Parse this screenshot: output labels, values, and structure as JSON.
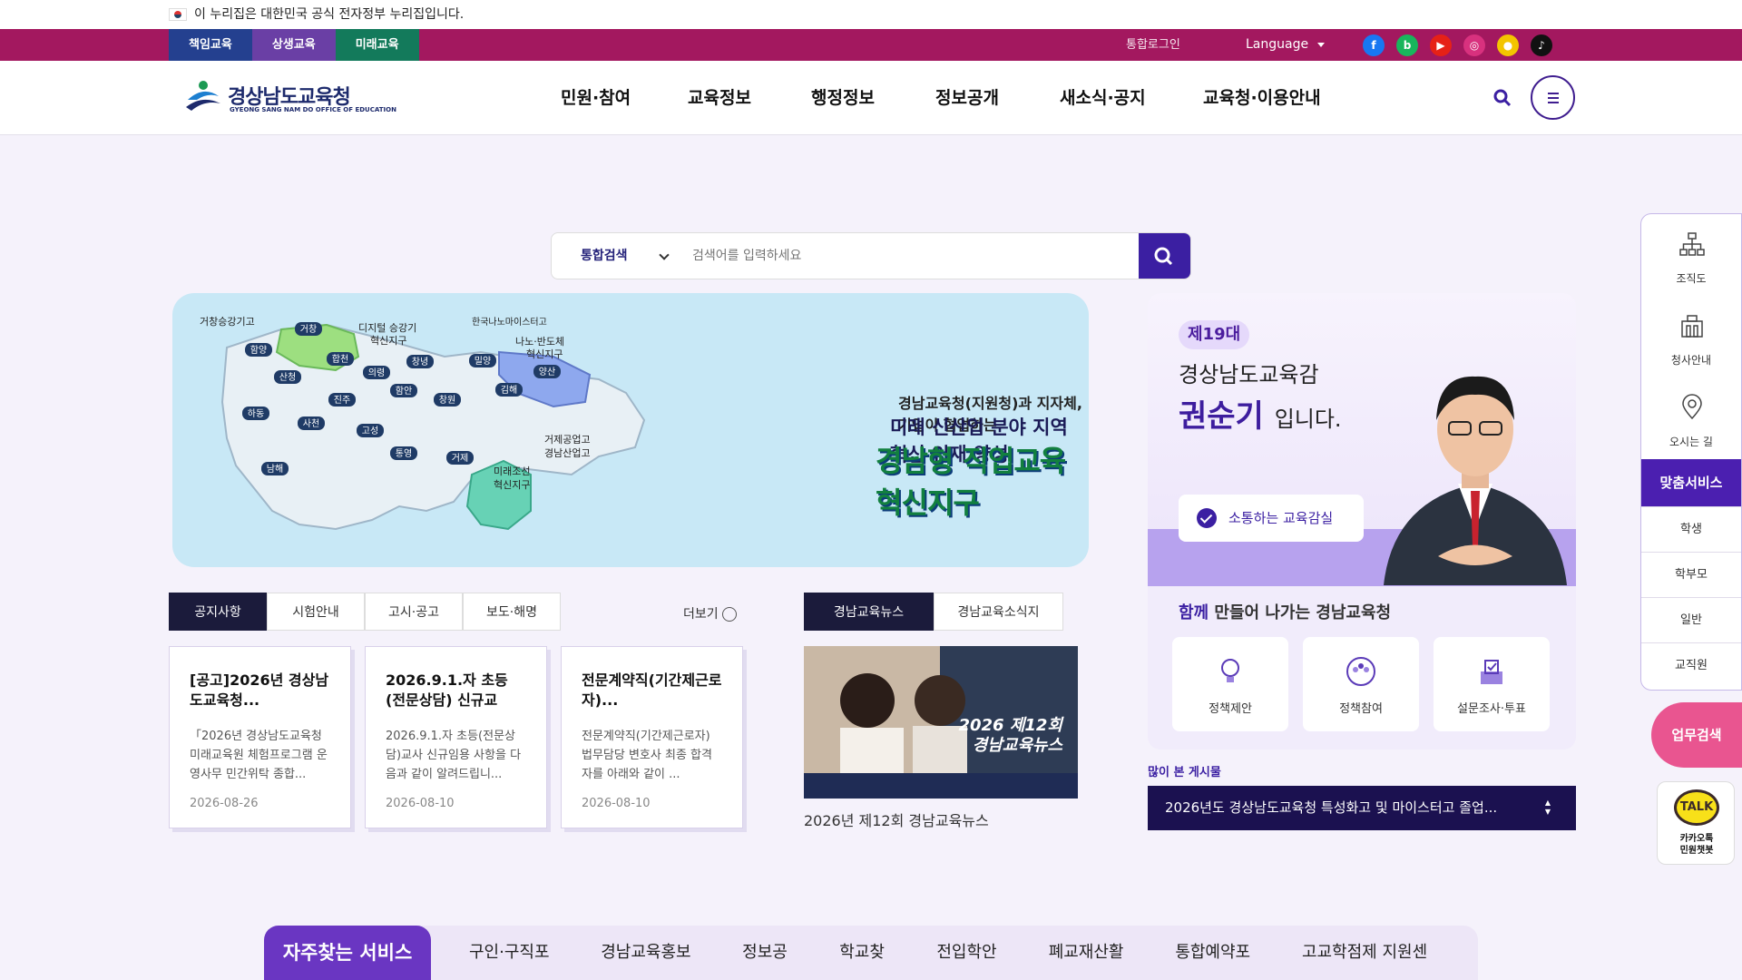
{
  "gov_notice": "이 누리집은 대한민국 공식 전자정부 누리집입니다.",
  "topbar": {
    "pills": [
      "책임교육",
      "상생교육",
      "미래교육"
    ],
    "login": "통합로그인",
    "language": "Language",
    "sns": [
      {
        "name": "facebook-icon",
        "glyph": "f",
        "color": "#1877f2"
      },
      {
        "name": "blog-icon",
        "glyph": "b",
        "color": "#19b55c"
      },
      {
        "name": "youtube-icon",
        "glyph": "▶",
        "color": "#e62117"
      },
      {
        "name": "instagram-icon",
        "glyph": "◎",
        "color": "#d8317e"
      },
      {
        "name": "kakaostory-icon",
        "glyph": "●",
        "color": "#f3c500"
      },
      {
        "name": "tiktok-icon",
        "glyph": "♪",
        "color": "#111111"
      }
    ]
  },
  "header": {
    "logo_name": "경상남도교육청",
    "logo_en": "GYEONG SANG NAM DO OFFICE OF EDUCATION",
    "nav": [
      "민원·참여",
      "교육정보",
      "행정정보",
      "정보공개",
      "새소식·공지",
      "교육청·이용안내"
    ]
  },
  "search": {
    "scope": "통합검색",
    "placeholder": "검색어를 입력하세요"
  },
  "banner": {
    "line1": "경남교육청(지원청)과 지자체, 기업이 협업하는",
    "line2": "미래 신산업 분야 지역 혁신 인재 양성",
    "line3": "경남형 직업교육 혁신지구",
    "map_labels": {
      "geochang_school": "거창승강기고",
      "digital_l1": "디지털 승강기",
      "digital_l2": "혁신지구",
      "nano_school": "한국나노마이스터고",
      "nano_l1": "나노·반도체",
      "nano_l2": "혁신지구",
      "geoje_school_l1": "거제공업고",
      "geoje_school_l2": "경남산업고",
      "ship_l1": "미래조선",
      "ship_l2": "혁신지구",
      "regions": [
        "거창",
        "함양",
        "합천",
        "창녕",
        "밀양",
        "양산",
        "산청",
        "의령",
        "함안",
        "김해",
        "진주",
        "창원",
        "하동",
        "사천",
        "고성",
        "통영",
        "거제",
        "남해"
      ]
    }
  },
  "notice": {
    "tabs": [
      "공지사항",
      "시험안내",
      "고시·공고",
      "보도·해명"
    ],
    "more": "더보기",
    "cards": [
      {
        "title": "[공고]2026년 경상남도교육청...",
        "desc": "「2026년 경상남도교육청 미래교육원 체험프로그램 운영사무 민간위탁 종합...",
        "date": "2026-08-26"
      },
      {
        "title": "2026.9.1.자 초등(전문상담) 신규교사...",
        "desc": "2026.9.1.자 초등(전문상담)교사 신규임용 사항을 다음과 같이 알려드립니...",
        "date": "2026-08-10"
      },
      {
        "title": "전문계약직(기간제근로자)...",
        "desc": "전문계약직(기간제근로자) 법무담당 변호사 최종 합격자를 아래와 같이 ...",
        "date": "2026-08-10"
      }
    ]
  },
  "news": {
    "tabs": [
      "경남교육뉴스",
      "경남교육소식지"
    ],
    "image_l1": "2026 제12회",
    "image_l2": "경남교육뉴스",
    "caption": "2026년 제12회 경남교육뉴스"
  },
  "profile": {
    "badge": "제19대",
    "line1": "경상남도교육감",
    "name": "권순기",
    "suffix": "입니다.",
    "comm": "소통하는 교육감실",
    "sub_strong": "함께",
    "sub_rest": " 만들어 나가는 경남교육청",
    "buttons": [
      "정책제안",
      "정책참여",
      "설문조사·투표"
    ]
  },
  "popular": {
    "heading": "많이 본 게시물",
    "item": "2026년도 경상남도교육청 특성화고 및 마이스터고 졸업..."
  },
  "quick": {
    "head": "자주찾는 서비스",
    "items": [
      "구인·구직포털",
      "경남교육홍보관",
      "정보공개",
      "학교찾기",
      "전입학안내",
      "폐교재산활용",
      "통합예약포털",
      "고교학점제 지원센터"
    ]
  },
  "side": {
    "items": [
      "조직도",
      "청사안내",
      "오시는 길"
    ],
    "head": "맞춤서비스",
    "subs": [
      "학생",
      "학부모",
      "일반",
      "교직원"
    ],
    "work": "업무검색",
    "kakao_badge": "TALK",
    "kakao_l1": "카카오톡",
    "kakao_l2": "민원챗봇"
  },
  "colors": {
    "topbar": "#a3185f",
    "primary": "#3b1fa2",
    "quick_head": "#6a36c2",
    "work": "#e95590"
  }
}
